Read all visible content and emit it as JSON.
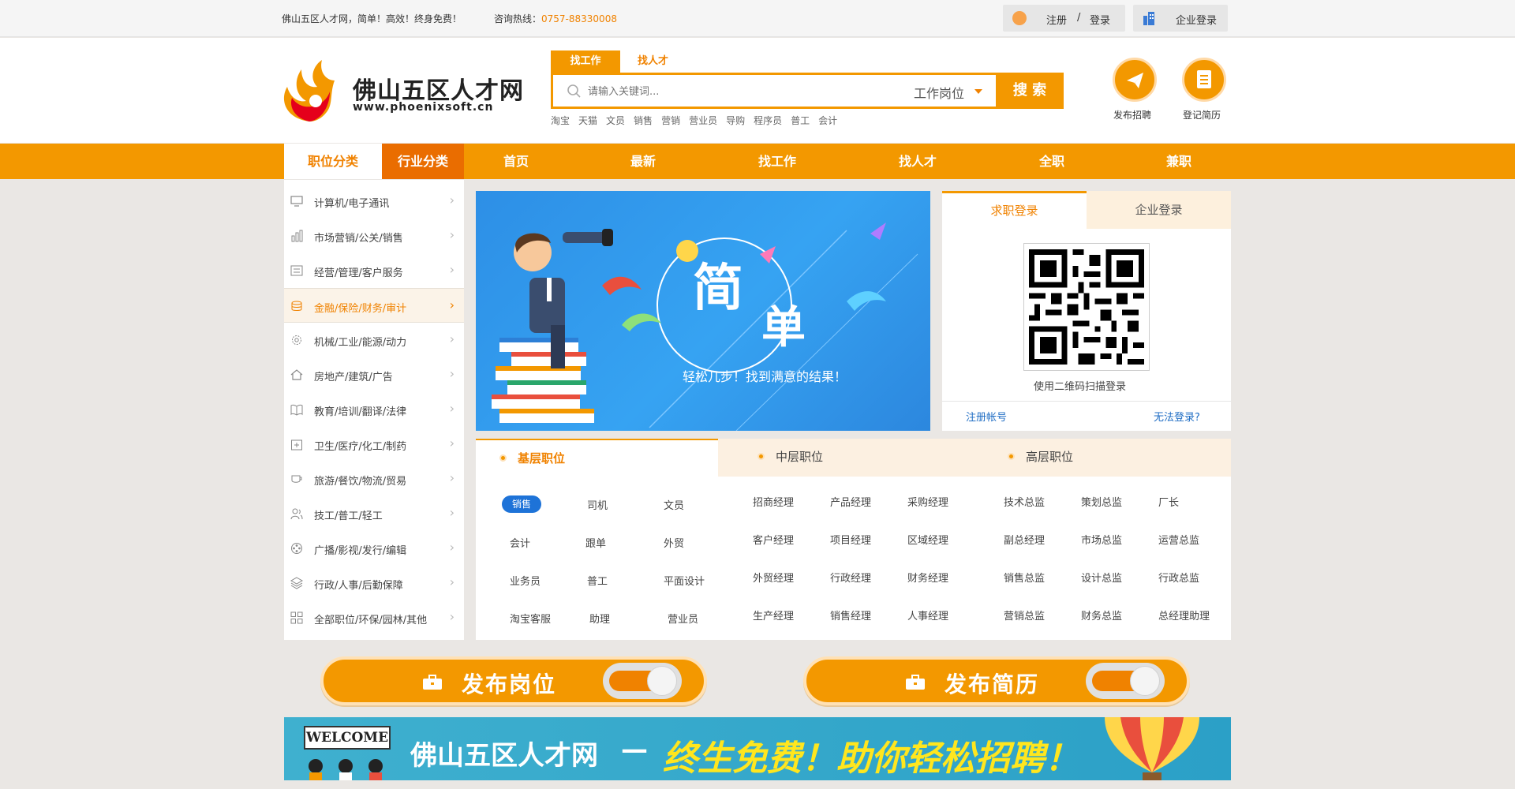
{
  "topbar": {
    "slogan": "佛山五区人才网，简单！高效！终身免费！",
    "hotline_label": "咨询热线：",
    "hotline_number": "0757-88330008",
    "register": "注册",
    "separator": "/",
    "login": "登录",
    "corp_login": "企业登录"
  },
  "header": {
    "logo_title": "佛山五区人才网",
    "logo_url": "www.phoenixsoft.cn",
    "search_tabs": [
      "找工作",
      "找人才"
    ],
    "search_placeholder": "请输入关键词...",
    "search_type": "工作岗位",
    "search_button": "搜 索",
    "hot_words": [
      "淘宝",
      "天猫",
      "文员",
      "销售",
      "营销",
      "营业员",
      "导购",
      "程序员",
      "普工",
      "会计"
    ],
    "post_job": "发布招聘",
    "register_resume": "登记简历"
  },
  "nav": {
    "position_category": "职位分类",
    "industry_category": "行业分类",
    "items": [
      "首页",
      "最新",
      "找工作",
      "找人才",
      "全职",
      "兼职"
    ]
  },
  "sidebar": {
    "categories": [
      {
        "label": "计算机/电子通讯",
        "icon": "monitor-icon"
      },
      {
        "label": "市场营销/公关/销售",
        "icon": "bar-chart-icon"
      },
      {
        "label": "经营/管理/客户服务",
        "icon": "list-icon"
      },
      {
        "label": "金融/保险/财务/审计",
        "icon": "coins-icon"
      },
      {
        "label": "机械/工业/能源/动力",
        "icon": "gear-icon"
      },
      {
        "label": "房地产/建筑/广告",
        "icon": "home-icon"
      },
      {
        "label": "教育/培训/翻译/法律",
        "icon": "book-icon"
      },
      {
        "label": "卫生/医疗/化工/制药",
        "icon": "medical-icon"
      },
      {
        "label": "旅游/餐饮/物流/贸易",
        "icon": "cup-icon"
      },
      {
        "label": "技工/普工/轻工",
        "icon": "users-icon"
      },
      {
        "label": "广播/影视/发行/编辑",
        "icon": "film-icon"
      },
      {
        "label": "行政/人事/后勤保障",
        "icon": "layers-icon"
      },
      {
        "label": "全部职位/环保/园林/其他",
        "icon": "grid-icon"
      }
    ],
    "active_index": 3,
    "arrow": "›"
  },
  "banner": {
    "big_text_1": "简",
    "big_text_2": "单",
    "tagline": "轻松几步！找到满意的结果！"
  },
  "login_panel": {
    "tab_job_seeker": "求职登录",
    "tab_company": "企业登录",
    "qr_caption": "使用二维码扫描登录",
    "register_link": "注册帐号",
    "cant_login": "无法登录?"
  },
  "positions": {
    "junior_title": "基层职位",
    "middle_title": "中层职位",
    "senior_title": "高层职位",
    "junior": [
      "销售",
      "司机",
      "文员",
      "会计",
      "跟单",
      "外贸",
      "业务员",
      "普工",
      "平面设计",
      "淘宝客服",
      "助理",
      "营业员"
    ],
    "middle": [
      "招商经理",
      "产品经理",
      "采购经理",
      "客户经理",
      "项目经理",
      "区域经理",
      "外贸经理",
      "行政经理",
      "财务经理",
      "生产经理",
      "销售经理",
      "人事经理"
    ],
    "senior": [
      "技术总监",
      "策划总监",
      "厂长",
      "副总经理",
      "市场总监",
      "运营总监",
      "销售总监",
      "设计总监",
      "行政总监",
      "营销总监",
      "财务总监",
      "总经理助理"
    ]
  },
  "publish": {
    "post_position": "发布岗位",
    "post_resume": "发布简历"
  },
  "promo": {
    "welcome": "WELCOME",
    "title": "佛山五区人才网",
    "dash": "—",
    "slogan": "终生免费！助你轻松招聘！"
  },
  "colors": {
    "brand_orange": "#f39800",
    "dark_orange": "#ea6d00",
    "link_blue": "#1f6dc4",
    "promo_yellow": "#ffe61e"
  }
}
